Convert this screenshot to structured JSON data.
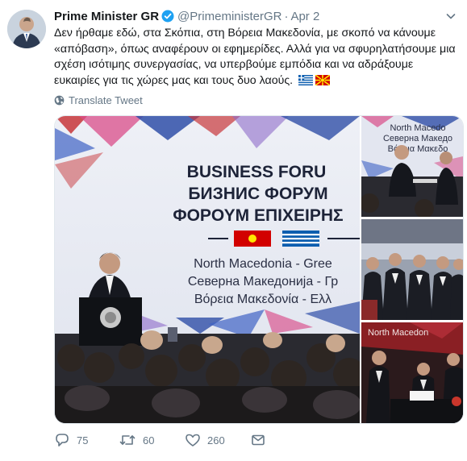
{
  "author": {
    "name": "Prime Minister GR",
    "handle": "@PrimeministerGR",
    "separator": "·",
    "date": "Apr 2"
  },
  "tweet": {
    "text": "Δεν ήρθαμε εδώ, στα Σκόπια, στη Βόρεια Μακεδονία, με σκοπό να κάνουμε «απόβαση», όπως αναφέρουν οι εφημερίδες. Αλλά για να σφυρηλατήσουμε μια σχέση ισότιμης συνεργασίας, να υπερβούμε εμπόδια και να αδράξουμε ευκαιρίες για τις χώρες μας και τους δυο λαούς.",
    "flags": [
      "greece-flag-icon",
      "north-macedonia-flag-icon"
    ]
  },
  "translate_label": "Translate Tweet",
  "media": {
    "banner_lines": [
      "BUSINESS FORU",
      "БИЗНИС ФОРУМ",
      "ΦΟΡΟΥΜ ΕΠΙΧΕΙΡΗΣ",
      "North Macedonia - Gree",
      "Северна Македонија - Гр",
      "Βόρεια Μακεδονία - Ελλ"
    ],
    "thumb1_lines": [
      "North Macedo",
      "Северна Македо",
      "Βόρεια Μακεδο"
    ],
    "thumb3_line": "North Macedon"
  },
  "actions": {
    "replies": "75",
    "retweets": "60",
    "likes": "260"
  },
  "colors": {
    "link_gray": "#657786",
    "verified": "#1da1f2",
    "banner_red": "#c7363a",
    "banner_blue": "#2f4fa8"
  }
}
